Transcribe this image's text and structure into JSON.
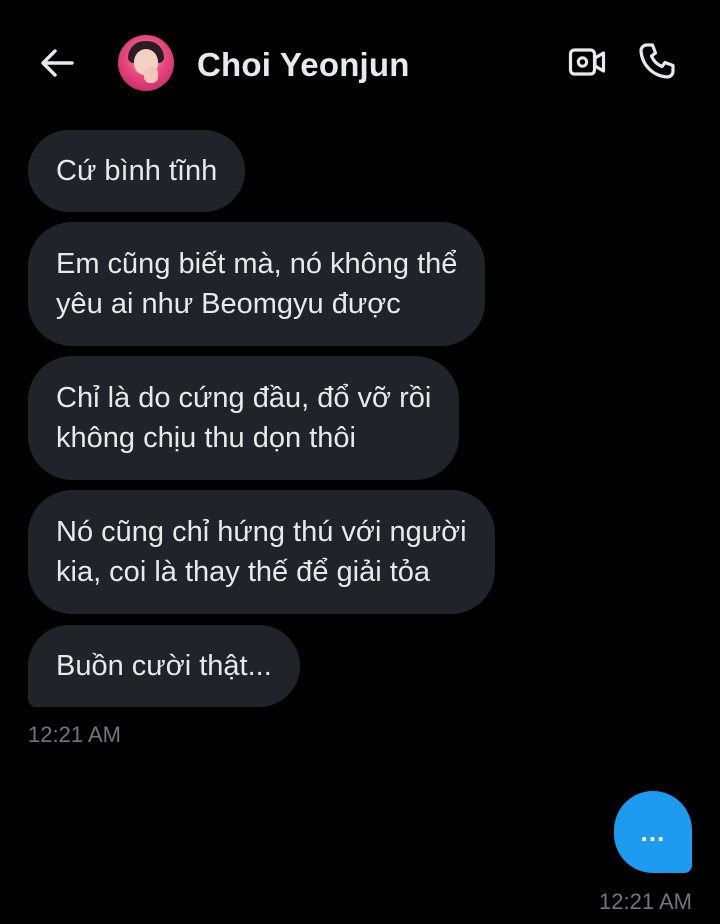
{
  "header": {
    "contact_name": "Choi Yeonjun",
    "icons": {
      "back": "arrow-left-icon",
      "video": "video-call-icon",
      "phone": "phone-call-icon",
      "avatar": "profile-avatar"
    }
  },
  "messages": [
    {
      "text": "Cứ bình tĩnh",
      "direction": "incoming"
    },
    {
      "text": "Em cũng biết mà, nó không thể\nyêu ai như Beomgyu được",
      "direction": "incoming"
    },
    {
      "text": "Chỉ là do cứng đầu, đổ vỡ rồi\nkhông chịu thu dọn thôi",
      "direction": "incoming"
    },
    {
      "text": "Nó cũng chỉ hứng thú với người\nkia, coi là thay thế để giải tỏa",
      "direction": "incoming"
    },
    {
      "text": "Buồn cười thật...",
      "direction": "incoming"
    }
  ],
  "incoming_timestamp": "12:21 AM",
  "outgoing": {
    "typing_indicator": "...",
    "timestamp": "12:21 AM"
  },
  "colors": {
    "background": "#000000",
    "incoming_bubble": "#202327",
    "outgoing_bubble": "#1d9bf0",
    "text_primary": "#e7e9ea",
    "text_secondary": "#71767b"
  }
}
